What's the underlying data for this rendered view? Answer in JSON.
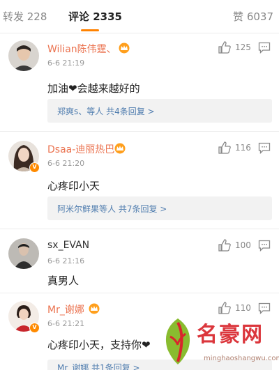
{
  "tabs": {
    "repost": "转发 228",
    "comments": "评论 2335",
    "likes": "赞 6037",
    "accent": "#ff8200"
  },
  "comments": [
    {
      "username": "Wilian陈伟霆、",
      "time": "6-6 21:19",
      "likes": "125",
      "text": "加油❤会越来越好的",
      "replies": "郑爽s、等人  共4条回复 >"
    },
    {
      "username": "Dsaa-迪丽热巴",
      "time": "6-6 21:20",
      "likes": "116",
      "text": "心疼印小天",
      "replies": "阿米尔鲜果等人  共7条回复 >"
    },
    {
      "username": "sx_EVAN",
      "time": "6-6 21:16",
      "likes": "100",
      "text": "真男人"
    },
    {
      "username": "Mr_谢娜",
      "time": "6-6 21:21",
      "likes": "110",
      "text": "心疼印小天，支持你❤",
      "replies": "Mr_谢娜  共1条回复 >"
    }
  ],
  "watermark": {
    "title": "名豪网",
    "url": "minghaoshangwu.com"
  },
  "colors": {
    "username": "#eb7350",
    "link": "#507daf",
    "heart": "#e53935"
  },
  "icons": [
    "thumbs-up-icon",
    "reply-icon",
    "crown-badge-icon",
    "verified-badge-icon"
  ]
}
